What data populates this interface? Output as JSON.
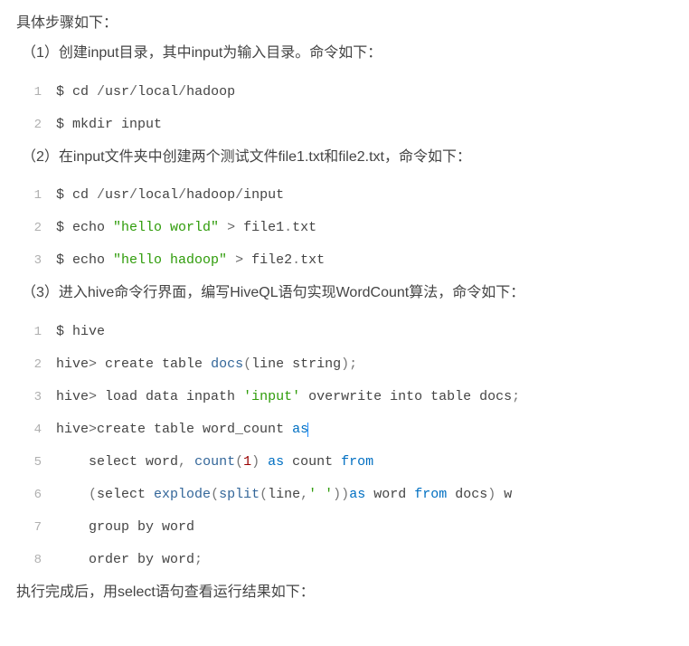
{
  "intro": "具体步骤如下：",
  "steps": [
    {
      "label": "（1）创建input目录，其中input为输入目录。命令如下：",
      "code": [
        {
          "n": "1",
          "tokens": [
            [
              "plain",
              "$ cd "
            ],
            [
              "op",
              "/"
            ],
            [
              "plain",
              "usr"
            ],
            [
              "op",
              "/"
            ],
            [
              "plain",
              "local"
            ],
            [
              "op",
              "/"
            ],
            [
              "plain",
              "hadoop"
            ]
          ]
        },
        {
          "n": "2",
          "tokens": [
            [
              "plain",
              "$ mkdir input"
            ]
          ]
        }
      ]
    },
    {
      "label": "（2）在input文件夹中创建两个测试文件file1.txt和file2.txt，命令如下：",
      "code": [
        {
          "n": "1",
          "tokens": [
            [
              "plain",
              "$ cd "
            ],
            [
              "op",
              "/"
            ],
            [
              "plain",
              "usr"
            ],
            [
              "op",
              "/"
            ],
            [
              "plain",
              "local"
            ],
            [
              "op",
              "/"
            ],
            [
              "plain",
              "hadoop"
            ],
            [
              "op",
              "/"
            ],
            [
              "plain",
              "input"
            ]
          ]
        },
        {
          "n": "2",
          "tokens": [
            [
              "plain",
              "$ echo "
            ],
            [
              "str",
              "\"hello world\""
            ],
            [
              "plain",
              " "
            ],
            [
              "op",
              ">"
            ],
            [
              "plain",
              " file1"
            ],
            [
              "punct",
              "."
            ],
            [
              "plain",
              "txt"
            ]
          ]
        },
        {
          "n": "3",
          "tokens": [
            [
              "plain",
              "$ echo "
            ],
            [
              "str",
              "\"hello hadoop\""
            ],
            [
              "plain",
              " "
            ],
            [
              "op",
              ">"
            ],
            [
              "plain",
              " file2"
            ],
            [
              "punct",
              "."
            ],
            [
              "plain",
              "txt"
            ]
          ]
        }
      ]
    },
    {
      "label": "（3）进入hive命令行界面，编写HiveQL语句实现WordCount算法，命令如下：",
      "code": [
        {
          "n": "1",
          "tokens": [
            [
              "plain",
              "$ hive"
            ]
          ]
        },
        {
          "n": "2",
          "tokens": [
            [
              "plain",
              "hive"
            ],
            [
              "op",
              ">"
            ],
            [
              "plain",
              " create table "
            ],
            [
              "ident",
              "docs"
            ],
            [
              "punct",
              "("
            ],
            [
              "plain",
              "line string"
            ],
            [
              "punct",
              ")"
            ],
            [
              "punct",
              ";"
            ]
          ]
        },
        {
          "n": "3",
          "tokens": [
            [
              "plain",
              "hive"
            ],
            [
              "op",
              ">"
            ],
            [
              "plain",
              " load data inpath "
            ],
            [
              "str",
              "'input'"
            ],
            [
              "plain",
              " overwrite into table docs"
            ],
            [
              "punct",
              ";"
            ]
          ]
        },
        {
          "n": "4",
          "tokens": [
            [
              "plain",
              "hive"
            ],
            [
              "op",
              ">"
            ],
            [
              "plain",
              "create table word_count "
            ],
            [
              "kw",
              "as"
            ]
          ],
          "cursor": true
        },
        {
          "n": "5",
          "tokens": [
            [
              "plain",
              "    select word"
            ],
            [
              "punct",
              ","
            ],
            [
              "plain",
              " "
            ],
            [
              "ident",
              "count"
            ],
            [
              "punct",
              "("
            ],
            [
              "num",
              "1"
            ],
            [
              "punct",
              ")"
            ],
            [
              "plain",
              " "
            ],
            [
              "kw",
              "as"
            ],
            [
              "plain",
              " count "
            ],
            [
              "kw",
              "from"
            ]
          ]
        },
        {
          "n": "6",
          "tokens": [
            [
              "plain",
              "    "
            ],
            [
              "punct",
              "("
            ],
            [
              "plain",
              "select "
            ],
            [
              "ident",
              "explode"
            ],
            [
              "punct",
              "("
            ],
            [
              "ident",
              "split"
            ],
            [
              "punct",
              "("
            ],
            [
              "plain",
              "line"
            ],
            [
              "punct",
              ","
            ],
            [
              "str",
              "' '"
            ],
            [
              "punct",
              ")"
            ],
            [
              "punct",
              ")"
            ],
            [
              "kw",
              "as"
            ],
            [
              "plain",
              " word "
            ],
            [
              "kw",
              "from"
            ],
            [
              "plain",
              " docs"
            ],
            [
              "punct",
              ")"
            ],
            [
              "plain",
              " w"
            ]
          ]
        },
        {
          "n": "7",
          "tokens": [
            [
              "plain",
              "    group by word"
            ]
          ]
        },
        {
          "n": "8",
          "tokens": [
            [
              "plain",
              "    order by word"
            ],
            [
              "punct",
              ";"
            ]
          ]
        }
      ]
    }
  ],
  "outro": "执行完成后，用select语句查看运行结果如下："
}
